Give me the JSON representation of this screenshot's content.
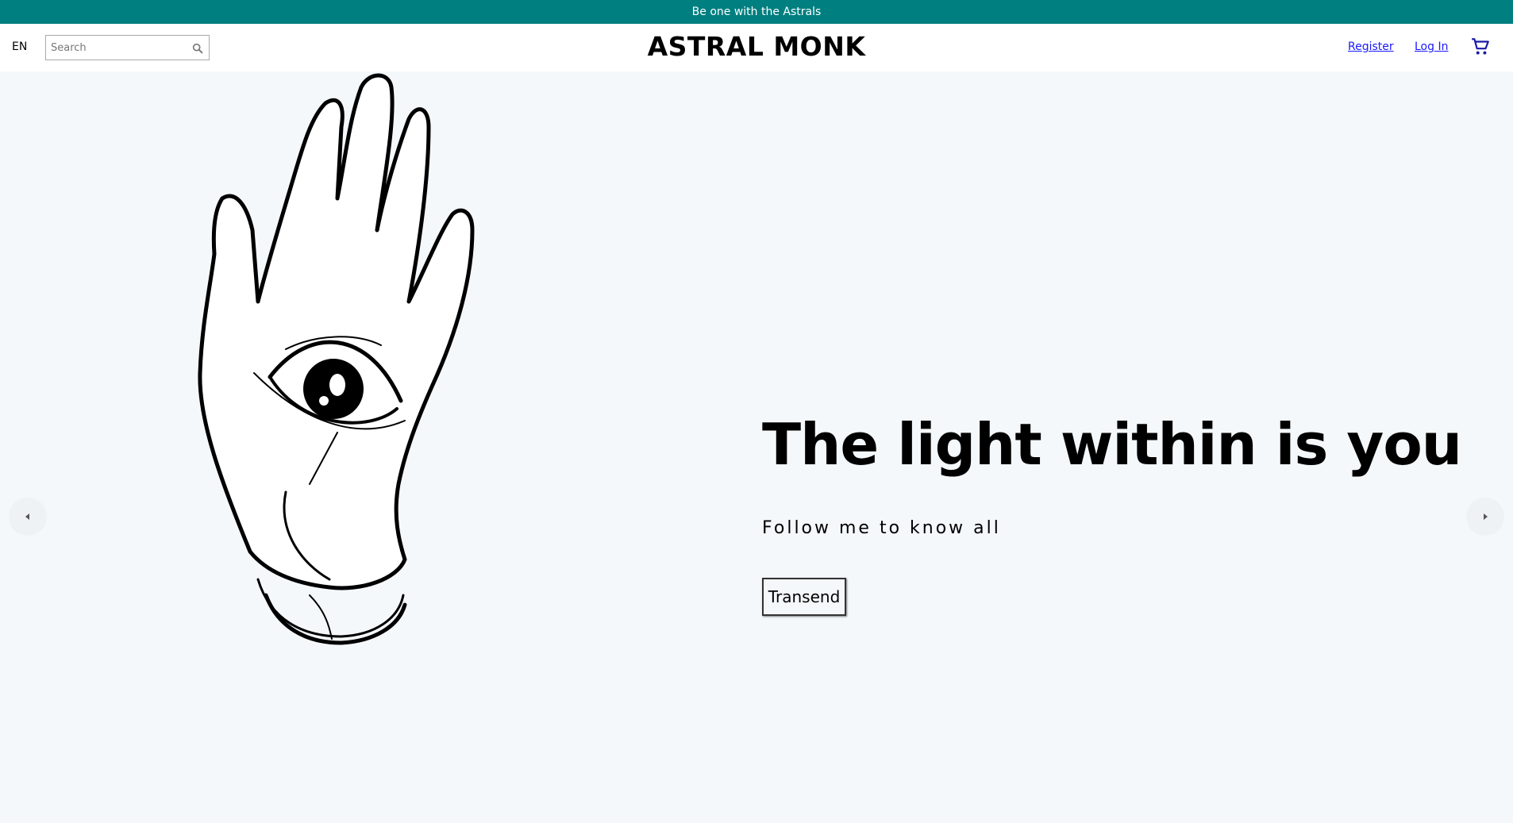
{
  "announcement": {
    "text": "Be one with the Astrals"
  },
  "header": {
    "language": "EN",
    "search": {
      "placeholder": "Search",
      "value": ""
    },
    "brand": "ASTRAL MONK",
    "register_label": "Register",
    "login_label": "Log In",
    "cart_icon": "cart-icon"
  },
  "hero": {
    "headline": "The light within is you",
    "subline": "Follow me to know all",
    "cta_label": "Transend",
    "image": "hand-with-eye-illustration",
    "prev_icon": "chevron-left-icon",
    "next_icon": "chevron-right-icon"
  },
  "colors": {
    "announcement_bg": "#007f80",
    "hero_bg": "#f4f8fa",
    "link": "#1a1aff"
  }
}
